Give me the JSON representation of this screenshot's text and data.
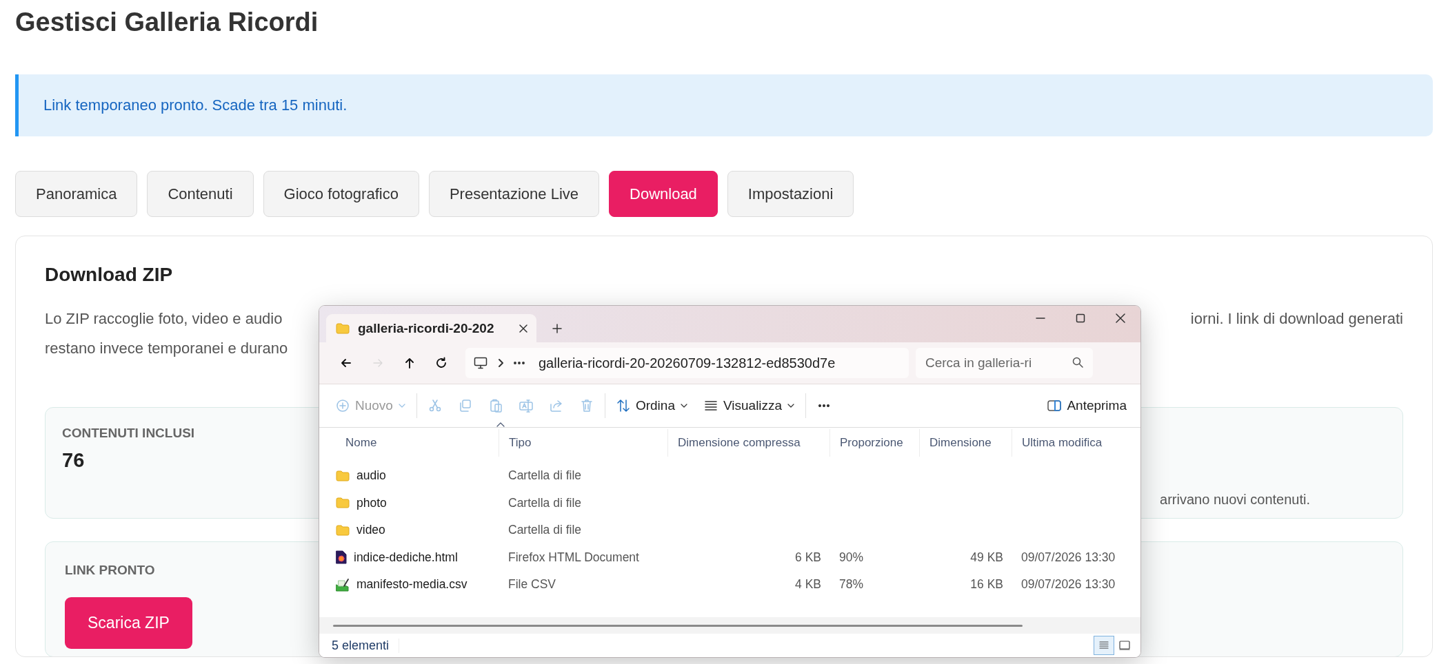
{
  "page_title": "Gestisci Galleria Ricordi",
  "alert": "Link temporaneo pronto. Scade tra 15 minuti.",
  "tabs": [
    {
      "label": "Panoramica",
      "selected": false
    },
    {
      "label": "Contenuti",
      "selected": false
    },
    {
      "label": "Gioco fotografico",
      "selected": false
    },
    {
      "label": "Presentazione Live",
      "selected": false
    },
    {
      "label": "Download",
      "selected": true
    },
    {
      "label": "Impostazioni",
      "selected": false
    }
  ],
  "panel": {
    "heading": "Download ZIP",
    "description_fragments": [
      "Lo ZIP raccoglie foto, video e audio",
      "iorni. I link di download generati",
      "restano invece temporanei e durano"
    ],
    "stats": [
      {
        "label": "CONTENUTI INCLUSI",
        "value": "76",
        "note": "arrivano nuovi contenuti."
      }
    ],
    "link": {
      "label": "LINK PRONTO",
      "button": "Scarica ZIP"
    }
  },
  "explorer": {
    "tab_title": "galleria-ricordi-20-202",
    "nav": [
      {
        "kind": "back",
        "disabled": false
      },
      {
        "kind": "forward",
        "disabled": true
      },
      {
        "kind": "up",
        "disabled": false
      },
      {
        "kind": "refresh",
        "disabled": false
      }
    ],
    "path": "galleria-ricordi-20-20260709-132812-ed8530d7e",
    "search_placeholder": "Cerca in galleria-ri",
    "toolbar": [
      {
        "kind": "new",
        "label": "Nuovo",
        "disabled": true
      },
      {
        "kind": "cut",
        "disabled": true
      },
      {
        "kind": "copy",
        "disabled": true
      },
      {
        "kind": "paste",
        "disabled": true
      },
      {
        "kind": "rename",
        "disabled": true
      },
      {
        "kind": "share",
        "disabled": true
      },
      {
        "kind": "delete",
        "disabled": true
      },
      {
        "kind": "sort",
        "label": "Ordina",
        "disabled": false
      },
      {
        "kind": "view",
        "label": "Visualizza",
        "disabled": false
      },
      {
        "kind": "more",
        "disabled": false
      },
      {
        "kind": "preview",
        "label": "Anteprima",
        "disabled": false
      }
    ],
    "columns": [
      "Nome",
      "Tipo",
      "Dimensione compressa",
      "Proporzione",
      "Dimensione",
      "Ultima modifica"
    ],
    "rows": [
      {
        "kind": "folder",
        "name": "audio",
        "type": "Cartella di file"
      },
      {
        "kind": "folder",
        "name": "photo",
        "type": "Cartella di file"
      },
      {
        "kind": "folder",
        "name": "video",
        "type": "Cartella di file"
      },
      {
        "kind": "html",
        "name": "indice-dediche.html",
        "type": "Firefox HTML Document",
        "compressed": "6 KB",
        "ratio": "90%",
        "size": "49 KB",
        "modified": "09/07/2026 13:30"
      },
      {
        "kind": "csv",
        "name": "manifesto-media.csv",
        "type": "File CSV",
        "compressed": "4 KB",
        "ratio": "78%",
        "size": "16 KB",
        "modified": "09/07/2026 13:30"
      }
    ],
    "status": "5 elementi",
    "view_buttons": [
      {
        "kind": "details",
        "selected": true
      },
      {
        "kind": "tiles",
        "selected": false
      }
    ]
  }
}
